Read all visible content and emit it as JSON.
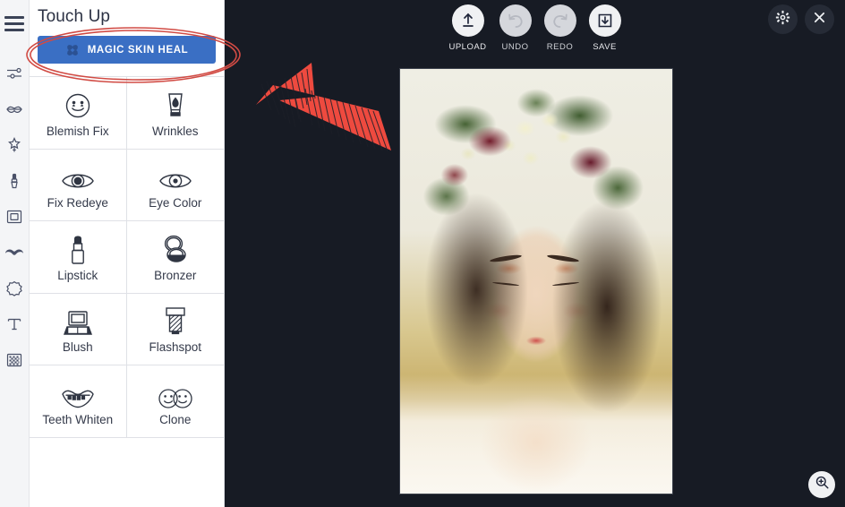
{
  "app": {
    "background_color": "#171b24",
    "panel_background": "#ffffff",
    "accent_color": "#3a6fc4",
    "annotation_color": "#e8392e"
  },
  "icon_rail": {
    "menu_icon": "hamburger-menu-icon",
    "items": [
      {
        "name": "adjust-icon",
        "title": "Adjust"
      },
      {
        "name": "lips-icon",
        "title": "Lips"
      },
      {
        "name": "magic-wand-icon",
        "title": "Magic Wand"
      },
      {
        "name": "brush-icon",
        "title": "Brush"
      },
      {
        "name": "frame-icon",
        "title": "Frame"
      },
      {
        "name": "mustache-icon",
        "title": "Mustache"
      },
      {
        "name": "sticker-icon",
        "title": "Sticker"
      },
      {
        "name": "text-icon",
        "title": "Text"
      },
      {
        "name": "texture-icon",
        "title": "Texture"
      }
    ]
  },
  "panel": {
    "title": "Touch Up",
    "magic_button_label": "MAGIC SKIN HEAL",
    "magic_button_icon": "bandage-icon",
    "tools": [
      {
        "label": "Blemish Fix",
        "icon": "smiley-face-icon"
      },
      {
        "label": "Wrinkles",
        "icon": "cream-tube-icon"
      },
      {
        "label": "Fix Redeye",
        "icon": "eye-solid-icon"
      },
      {
        "label": "Eye Color",
        "icon": "eye-iris-icon"
      },
      {
        "label": "Lipstick",
        "icon": "lipstick-icon"
      },
      {
        "label": "Bronzer",
        "icon": "compact-powder-icon"
      },
      {
        "label": "Blush",
        "icon": "blush-palette-icon"
      },
      {
        "label": "Flashspot",
        "icon": "flash-stamp-icon"
      },
      {
        "label": "Teeth Whiten",
        "icon": "smiling-teeth-icon"
      },
      {
        "label": "Clone",
        "icon": "two-faces-icon"
      }
    ]
  },
  "toolbar": {
    "items": [
      {
        "label": "UPLOAD",
        "icon": "upload-arrow-icon",
        "disabled": false
      },
      {
        "label": "UNDO",
        "icon": "undo-arrow-icon",
        "disabled": true
      },
      {
        "label": "REDO",
        "icon": "redo-arrow-icon",
        "disabled": true
      },
      {
        "label": "SAVE",
        "icon": "save-disk-icon",
        "disabled": false
      }
    ],
    "settings_icon": "gear-icon",
    "close_icon": "close-x-icon"
  },
  "canvas": {
    "photo_alt": "portrait of a woman wearing a floral crown",
    "zoom_icon": "zoom-in-magnifier-icon"
  },
  "annotations": {
    "ellipse_target": "MAGIC SKIN HEAL",
    "arrow_direction": "up-left"
  }
}
